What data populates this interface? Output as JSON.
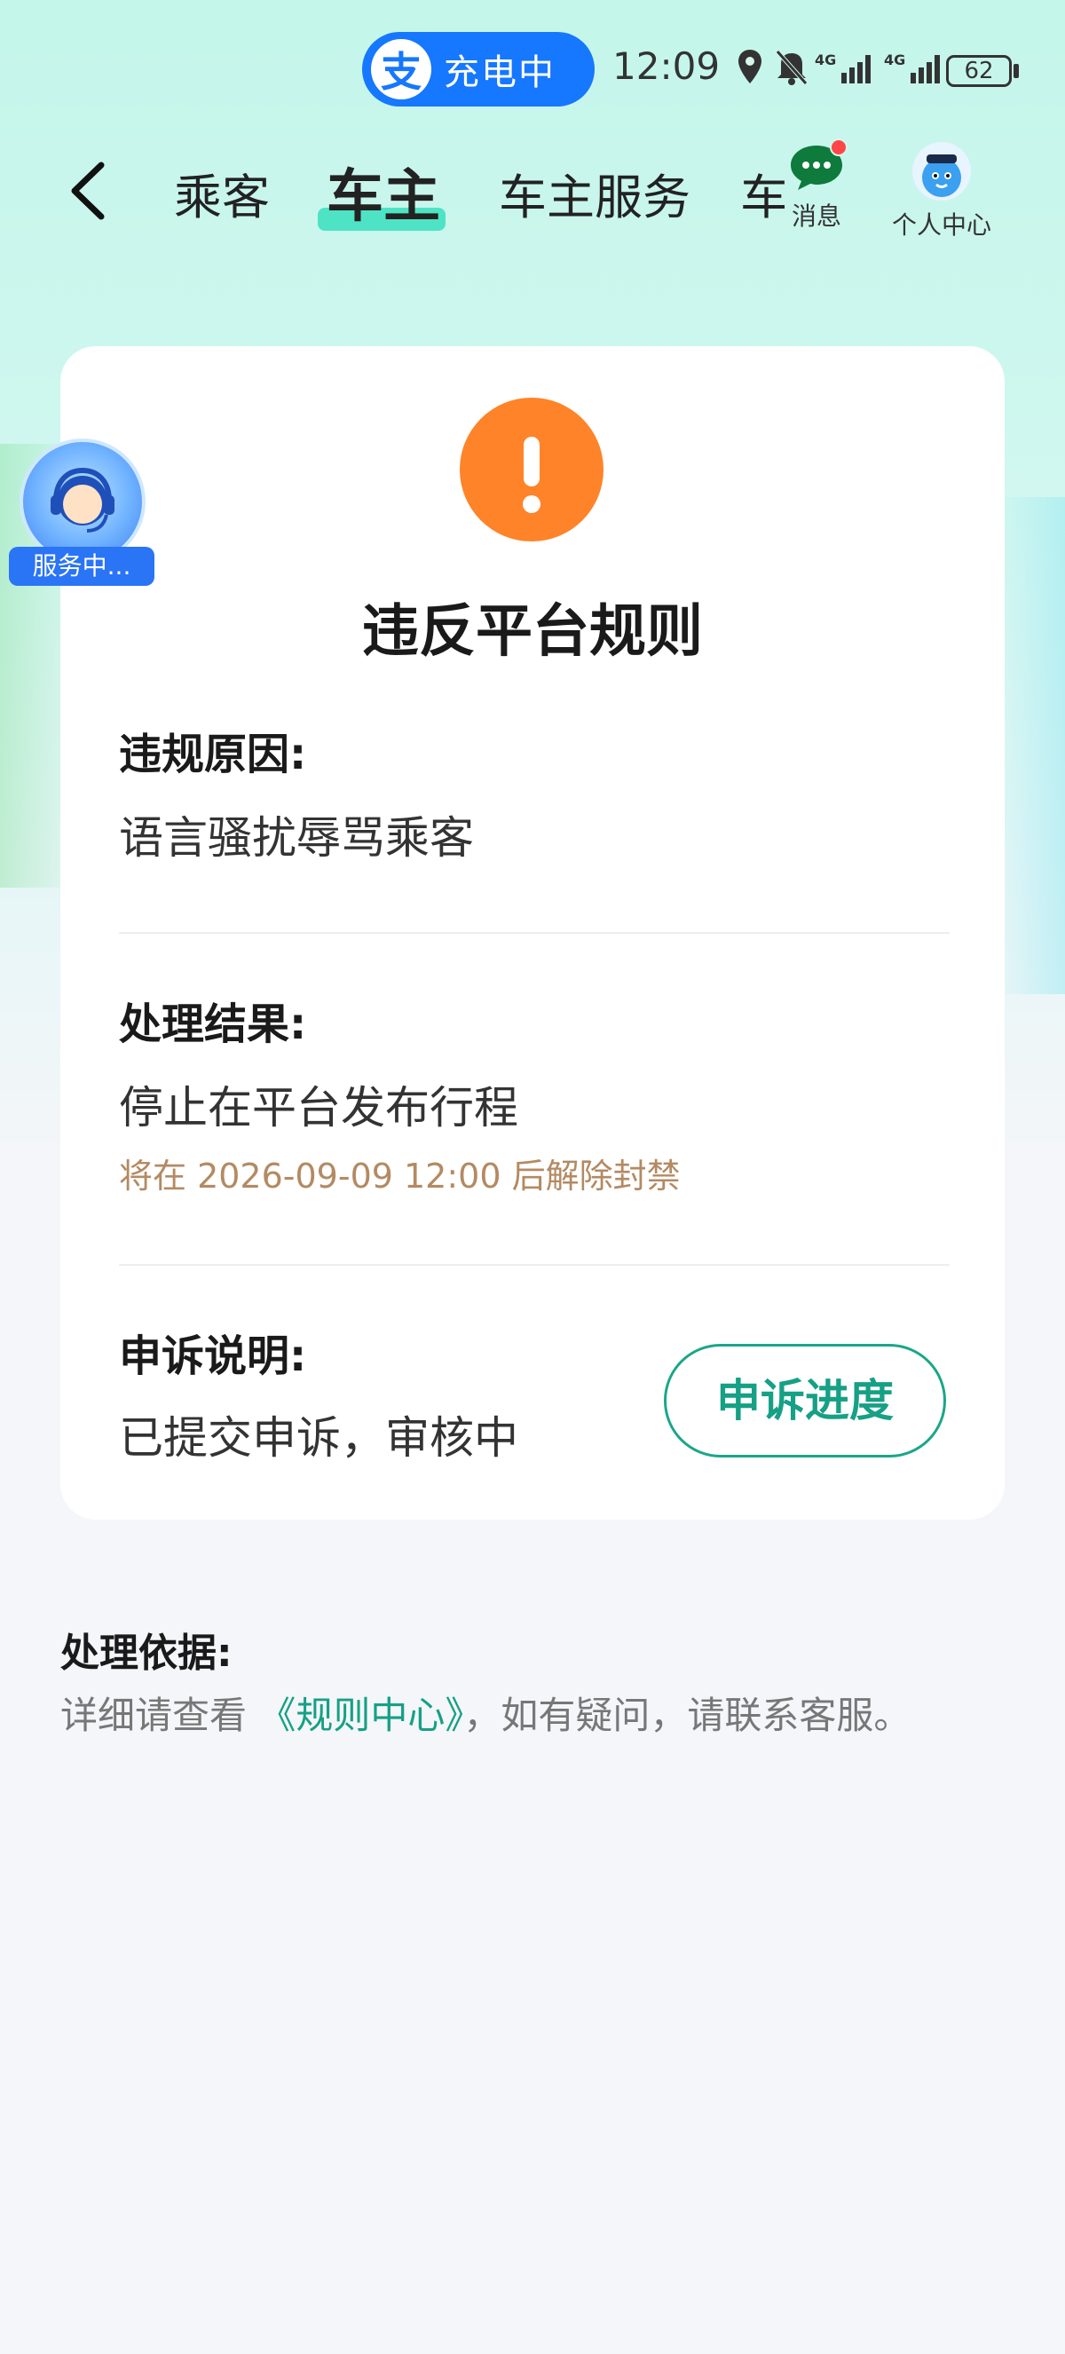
{
  "status_bar": {
    "alipay_logo_text": "支",
    "charging_label": "充电中",
    "time": "12:09",
    "network_label": "4G",
    "battery_level": "62"
  },
  "nav": {
    "tabs": [
      {
        "label": "乘客"
      },
      {
        "label": "车主",
        "active": true
      },
      {
        "label": "车主服务"
      },
      {
        "label": "车"
      }
    ],
    "messages_label": "消息",
    "profile_label": "个人中心"
  },
  "floating_service": {
    "label": "服务中..."
  },
  "card": {
    "title": "违反平台规则",
    "violation_reason": {
      "label": "违规原因:",
      "value": "语言骚扰辱骂乘客"
    },
    "result": {
      "label": "处理结果:",
      "value": "停止在平台发布行程",
      "note": "将在 2026-09-09 12:00 后解除封禁"
    },
    "appeal": {
      "label": "申诉说明:",
      "value": "已提交申诉，审核中",
      "button_label": "申诉进度"
    }
  },
  "basis": {
    "title": "处理依据:",
    "text_before": "详细请查看 ",
    "link_label": "《规则中心》",
    "text_after": "，如有疑问，请联系客服。"
  },
  "colors": {
    "accent_teal": "#16a085",
    "warning_orange": "#ff8328",
    "note_brown": "#b38a62",
    "alipay_blue": "#1677ff"
  }
}
